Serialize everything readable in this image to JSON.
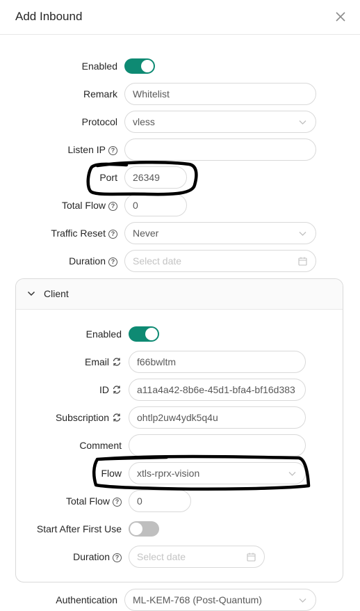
{
  "modal": {
    "title": "Add Inbound",
    "close_icon": "close-icon"
  },
  "form": {
    "enabled": {
      "label": "Enabled",
      "value": true
    },
    "remark": {
      "label": "Remark",
      "value": "Whitelist"
    },
    "protocol": {
      "label": "Protocol",
      "value": "vless"
    },
    "listen_ip": {
      "label": "Listen IP",
      "value": ""
    },
    "port": {
      "label": "Port",
      "value": "26349"
    },
    "total_flow": {
      "label": "Total Flow",
      "value": "0"
    },
    "traffic_reset": {
      "label": "Traffic Reset",
      "value": "Never"
    },
    "duration": {
      "label": "Duration",
      "placeholder": "Select date"
    }
  },
  "client": {
    "title": "Client",
    "enabled": {
      "label": "Enabled",
      "value": true
    },
    "email": {
      "label": "Email",
      "value": "f66bwltm"
    },
    "id": {
      "label": "ID",
      "value": "a11a4a42-8b6e-45d1-bfa4-bf16d383"
    },
    "subscription": {
      "label": "Subscription",
      "value": "ohtlp2uw4ydk5q4u"
    },
    "comment": {
      "label": "Comment",
      "value": ""
    },
    "flow": {
      "label": "Flow",
      "value": "xtls-rprx-vision"
    },
    "total_flow": {
      "label": "Total Flow",
      "value": "0"
    },
    "start_after_first_use": {
      "label": "Start After First Use",
      "value": false
    },
    "duration": {
      "label": "Duration",
      "placeholder": "Select date"
    }
  },
  "authentication": {
    "label": "Authentication",
    "value": "ML-KEM-768 (Post-Quantum)"
  },
  "colors": {
    "accent": "#0e8a73",
    "annotation": "#000000"
  }
}
